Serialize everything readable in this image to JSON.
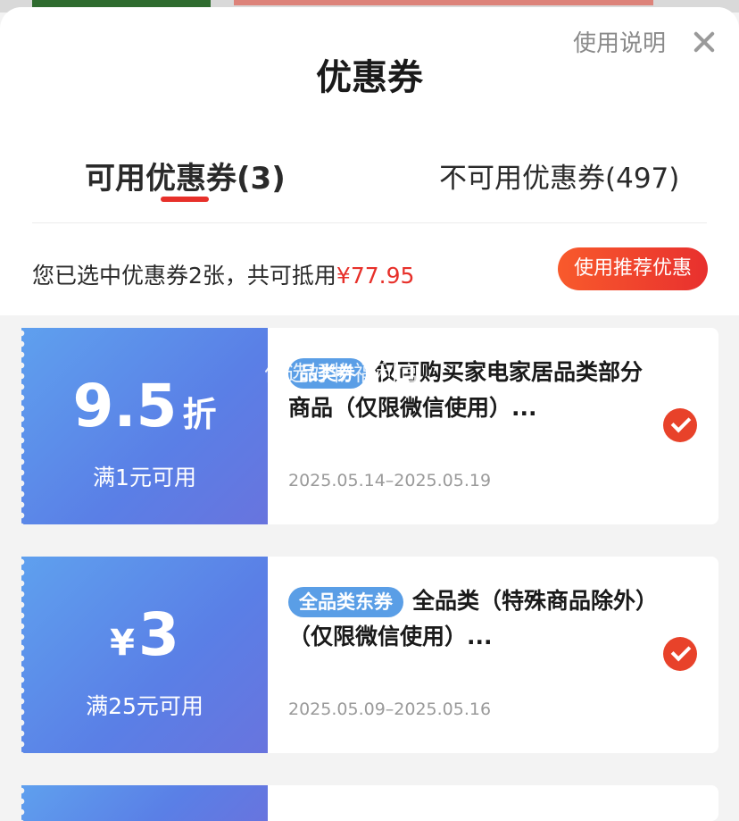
{
  "header": {
    "title": "优惠券",
    "help_label": "使用说明"
  },
  "tabs": {
    "available": "可用优惠券(3)",
    "unavailable": "不可用优惠券(497)"
  },
  "summary": {
    "text": "您已选中优惠券2张，共可抵用",
    "amount": "¥77.95",
    "recommend_button": "使用推荐优惠"
  },
  "watermark": "优选好物福利官",
  "coupons": [
    {
      "value": "9.5",
      "unit": "折",
      "condition": "满1元可用",
      "tag": "品类券",
      "description": "仅可购买家电家居品类部分商品（仅限微信使用）...",
      "validity": "2025.05.14–2025.05.19",
      "selected": true
    },
    {
      "currency": "¥",
      "value": "3",
      "condition": "满25元可用",
      "tag": "全品类东券",
      "description": "全品类（特殊商品除外）（仅限微信使用）...",
      "validity": "2025.05.09–2025.05.16",
      "selected": true
    }
  ],
  "colors": {
    "accent_red": "#e7302a",
    "coupon_blue": "#5a7fe6",
    "tag_blue": "#5a9ee6"
  }
}
